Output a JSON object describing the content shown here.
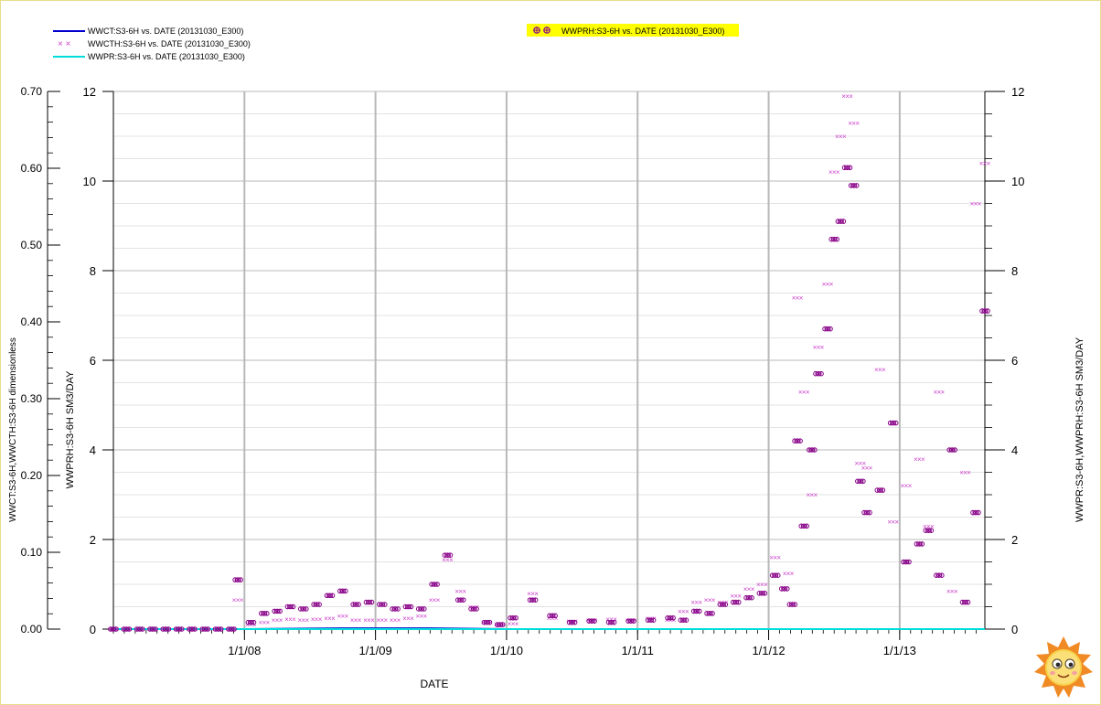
{
  "chart_data": {
    "type": "scatter",
    "title": "",
    "xlabel": "DATE",
    "ylabel_left_outer": "WWCT:S3-6H,WWCTH:S3-6H   dimensionless",
    "ylabel_left_inner": "WWPRH:S3-6H   SM3/DAY",
    "ylabel_right": "WWPR:S3-6H,WWPRH:S3-6H   SM3/DAY",
    "x_ticks": [
      "1/1/08",
      "1/1/09",
      "1/1/10",
      "1/1/11",
      "1/1/12",
      "1/1/13"
    ],
    "x_range": [
      2007.0,
      2013.65
    ],
    "y_left_outer_ticks": [
      "0.00",
      "0.10",
      "0.20",
      "0.30",
      "0.40",
      "0.50",
      "0.60",
      "0.70"
    ],
    "y_left_outer_range": [
      0,
      0.7
    ],
    "y_left_inner_ticks": [
      "0",
      "2",
      "4",
      "6",
      "8",
      "10",
      "12"
    ],
    "y_left_inner_range": [
      0,
      12
    ],
    "y_right_ticks": [
      "0",
      "2",
      "4",
      "6",
      "8",
      "10",
      "12"
    ],
    "y_right_range": [
      0,
      12
    ],
    "grid": true,
    "legend": [
      {
        "label": "WWCT:S3-6H  vs.  DATE (20131030_E300)",
        "marker": "line",
        "color": "#0000cc"
      },
      {
        "label": "WWCTH:S3-6H  vs.  DATE (20131030_E300)",
        "marker": "x",
        "color": "#cc44cc"
      },
      {
        "label": "WWPR:S3-6H  vs.  DATE (20131030_E300)",
        "marker": "line",
        "color": "#00dddd"
      },
      {
        "label": "WWPRH:S3-6H  vs.  DATE (20131030_E300)",
        "marker": "circle-plus",
        "color": "#880088",
        "highlight": "#ffff00"
      }
    ],
    "series": [
      {
        "name": "WWCT:S3-6H",
        "axis": "left_outer",
        "style": "line",
        "color": "#0000cc",
        "x": [
          2007.0,
          2008.0,
          2008.75,
          2009.4,
          2010.0,
          2011.0,
          2012.0,
          2013.0,
          2013.65
        ],
        "y": [
          0.0,
          0.0,
          0.001,
          0.001,
          0.0,
          0.0,
          0.0,
          0.0,
          0.0
        ]
      },
      {
        "name": "WWPR:S3-6H",
        "axis": "right",
        "style": "line",
        "color": "#00dddd",
        "x": [
          2007.0,
          2008.0,
          2009.0,
          2010.0,
          2011.0,
          2012.0,
          2013.0,
          2013.65
        ],
        "y": [
          0.0,
          0.0,
          0.0,
          0.0,
          0.0,
          0.0,
          0.0,
          0.0
        ]
      },
      {
        "name": "WWCTH:S3-6H",
        "axis": "left_inner",
        "style": "x",
        "color": "#cc44cc",
        "x": [
          2007.0,
          2007.1,
          2007.2,
          2007.3,
          2007.4,
          2007.5,
          2007.6,
          2007.7,
          2007.8,
          2007.9,
          2007.95,
          2008.05,
          2008.15,
          2008.25,
          2008.35,
          2008.45,
          2008.55,
          2008.65,
          2008.75,
          2008.85,
          2008.95,
          2009.05,
          2009.15,
          2009.25,
          2009.35,
          2009.45,
          2009.55,
          2009.65,
          2009.75,
          2009.85,
          2009.95,
          2010.05,
          2010.2,
          2010.35,
          2010.5,
          2010.65,
          2010.8,
          2010.95,
          2011.1,
          2011.25,
          2011.35,
          2011.45,
          2011.55,
          2011.65,
          2011.75,
          2011.85,
          2011.95,
          2012.05,
          2012.15,
          2012.22,
          2012.27,
          2012.33,
          2012.38,
          2012.45,
          2012.5,
          2012.55,
          2012.6,
          2012.65,
          2012.7,
          2012.75,
          2012.85,
          2012.95,
          2013.05,
          2013.15,
          2013.22,
          2013.3,
          2013.4,
          2013.5,
          2013.58,
          2013.65
        ],
        "y": [
          0,
          0,
          0,
          0,
          0,
          0,
          0,
          0,
          0,
          0,
          0.65,
          0.1,
          0.15,
          0.2,
          0.22,
          0.2,
          0.22,
          0.25,
          0.3,
          0.2,
          0.2,
          0.2,
          0.2,
          0.25,
          0.3,
          0.65,
          1.55,
          0.85,
          0.5,
          0.15,
          0.1,
          0.12,
          0.8,
          0.25,
          0.18,
          0.2,
          0.22,
          0.2,
          0.25,
          0.2,
          0.4,
          0.6,
          0.65,
          0.6,
          0.75,
          0.9,
          1.0,
          1.6,
          1.25,
          7.4,
          5.3,
          3.0,
          6.3,
          7.7,
          10.2,
          11.0,
          11.9,
          11.3,
          3.7,
          3.6,
          5.8,
          2.4,
          3.2,
          3.8,
          2.3,
          5.3,
          0.85,
          3.5,
          9.5,
          10.4
        ]
      },
      {
        "name": "WWPRH:S3-6H",
        "axis": "right",
        "style": "circle-plus",
        "color": "#880088",
        "x": [
          2007.0,
          2007.1,
          2007.2,
          2007.3,
          2007.4,
          2007.5,
          2007.6,
          2007.7,
          2007.8,
          2007.9,
          2007.95,
          2008.05,
          2008.15,
          2008.25,
          2008.35,
          2008.45,
          2008.55,
          2008.65,
          2008.75,
          2008.85,
          2008.95,
          2009.05,
          2009.15,
          2009.25,
          2009.35,
          2009.45,
          2009.55,
          2009.65,
          2009.75,
          2009.85,
          2009.95,
          2010.05,
          2010.2,
          2010.35,
          2010.5,
          2010.65,
          2010.8,
          2010.95,
          2011.1,
          2011.25,
          2011.35,
          2011.45,
          2011.55,
          2011.65,
          2011.75,
          2011.85,
          2011.95,
          2012.05,
          2012.12,
          2012.18,
          2012.22,
          2012.27,
          2012.33,
          2012.38,
          2012.45,
          2012.5,
          2012.55,
          2012.6,
          2012.65,
          2012.7,
          2012.75,
          2012.85,
          2012.95,
          2013.05,
          2013.15,
          2013.22,
          2013.3,
          2013.4,
          2013.5,
          2013.58,
          2013.65
        ],
        "y": [
          0,
          0,
          0,
          0,
          0,
          0,
          0,
          0,
          0,
          0,
          1.1,
          0.15,
          0.35,
          0.4,
          0.5,
          0.45,
          0.55,
          0.75,
          0.85,
          0.55,
          0.6,
          0.55,
          0.45,
          0.5,
          0.45,
          1.0,
          1.65,
          0.65,
          0.45,
          0.15,
          0.1,
          0.25,
          0.65,
          0.3,
          0.15,
          0.18,
          0.15,
          0.18,
          0.2,
          0.25,
          0.2,
          0.4,
          0.35,
          0.55,
          0.6,
          0.7,
          0.8,
          1.2,
          0.9,
          0.55,
          4.2,
          2.3,
          4.0,
          5.7,
          6.7,
          8.7,
          9.1,
          10.3,
          9.9,
          3.3,
          2.6,
          3.1,
          4.6,
          1.5,
          1.9,
          2.2,
          1.2,
          4.0,
          0.6,
          2.6,
          7.1
        ]
      }
    ]
  },
  "legend_highlight_color": "#ffff00",
  "grid_color": "#c8c8c8",
  "frame_color": "#e6e08a"
}
